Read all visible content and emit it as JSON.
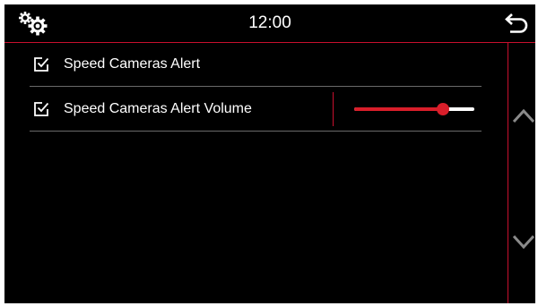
{
  "header": {
    "time": "12:00",
    "settings_icon": "gears-icon",
    "back_icon": "return-arrow-icon"
  },
  "settings": [
    {
      "label": "Speed Cameras Alert",
      "checked": true
    },
    {
      "label": "Speed Cameras Alert Volume",
      "checked": true,
      "volume_fraction": 0.74
    }
  ],
  "scroll": {
    "up_icon": "chevron-up-icon",
    "down_icon": "chevron-down-icon"
  },
  "colors": {
    "accent": "#c8102e",
    "slider_fill": "#d91e2a",
    "background": "#000000",
    "text": "#ffffff",
    "separator": "#6a6a6a"
  }
}
